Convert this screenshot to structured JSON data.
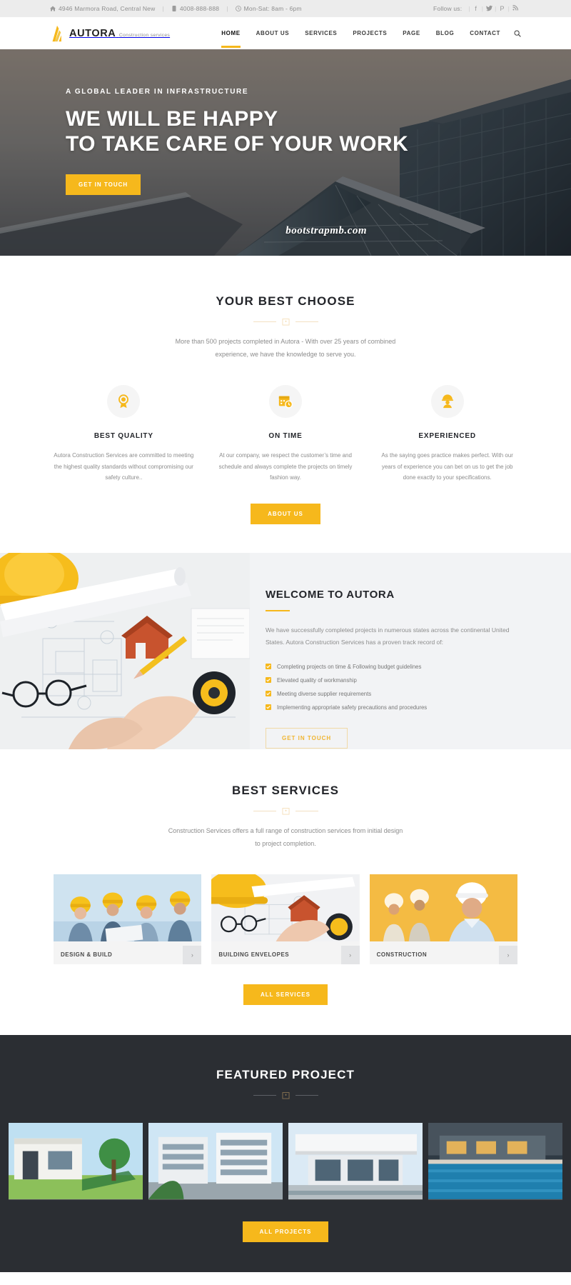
{
  "topbar": {
    "address": "4946 Marmora Road, Central New",
    "phone": "4008-888-888",
    "hours": "Mon-Sat: 8am - 6pm",
    "follow_label": "Follow us:",
    "socials": [
      "f",
      "𝘆",
      "P",
      "•"
    ],
    "social_names": [
      "facebook",
      "twitter",
      "pinterest",
      "rss"
    ],
    "separator": "|"
  },
  "header": {
    "brand_name": "AUTORA",
    "brand_sub": "Construction services",
    "nav": [
      {
        "label": "HOME",
        "active": true
      },
      {
        "label": "ABOUT US",
        "active": false
      },
      {
        "label": "SERVICES",
        "active": false
      },
      {
        "label": "PROJECTS",
        "active": false
      },
      {
        "label": "PAGE",
        "active": false
      },
      {
        "label": "BLOG",
        "active": false
      },
      {
        "label": "CONTACT",
        "active": false
      }
    ],
    "search_icon": "search-icon"
  },
  "hero": {
    "kicker": "A GLOBAL LEADER IN INFRASTRUCTURE",
    "title_line1": "WE WILL BE HAPPY",
    "title_line2": "TO TAKE CARE OF YOUR WORK",
    "cta": "GET IN TOUCH",
    "watermark": "bootstrapmb.com"
  },
  "choose": {
    "title": "YOUR BEST CHOOSE",
    "subtitle": "More than 500 projects completed in Autora - With over 25 years of combined experience, we have the knowledge to serve you.",
    "items": [
      {
        "icon": "award-badge-icon",
        "title": "BEST QUALITY",
        "text": "Autora Construction Services are committed to meeting the highest quality standards without compromising our safety culture.."
      },
      {
        "icon": "calendar-clock-icon",
        "title": "ON TIME",
        "text": "At our company, we respect the customer’s time and schedule and always complete the projects on timely fashion way."
      },
      {
        "icon": "worker-helmet-icon",
        "title": "EXPERIENCED",
        "text": "As the saying goes practice makes perfect. With our years of experience you can bet on us to get the job done exactly to your specifications."
      }
    ],
    "cta": "ABOUT US"
  },
  "welcome": {
    "title": "WELCOME TO AUTORA",
    "text": "We have successfully completed projects in numerous states across the continental United States. Autora Construction Services has a proven track record of:",
    "checklist": [
      "Completing projects on time & Following budget guidelines",
      "Elevated quality of workmanship",
      "Meeting diverse supplier requirements",
      "Implementing appropriate safety precautions and procedures"
    ],
    "cta": "GET IN TOUCH"
  },
  "services": {
    "title": "BEST SERVICES",
    "subtitle": "Construction Services offers a full range of construction services from initial design to project completion.",
    "cards": [
      {
        "label": "DESIGN & BUILD",
        "arrow": "›"
      },
      {
        "label": "BUILDING ENVELOPES",
        "arrow": "›"
      },
      {
        "label": "CONSTRUCTION",
        "arrow": "›"
      }
    ],
    "cta": "ALL SERVICES"
  },
  "featured": {
    "title": "FEATURED PROJECT",
    "cta": "ALL PROJECTS",
    "projects": [
      "project-1",
      "project-2",
      "project-3",
      "project-4"
    ]
  },
  "colors": {
    "accent": "#f6b81c",
    "dark": "#2b2e33",
    "topbar_bg": "#ececec",
    "muted_text": "#8c8c8c"
  }
}
